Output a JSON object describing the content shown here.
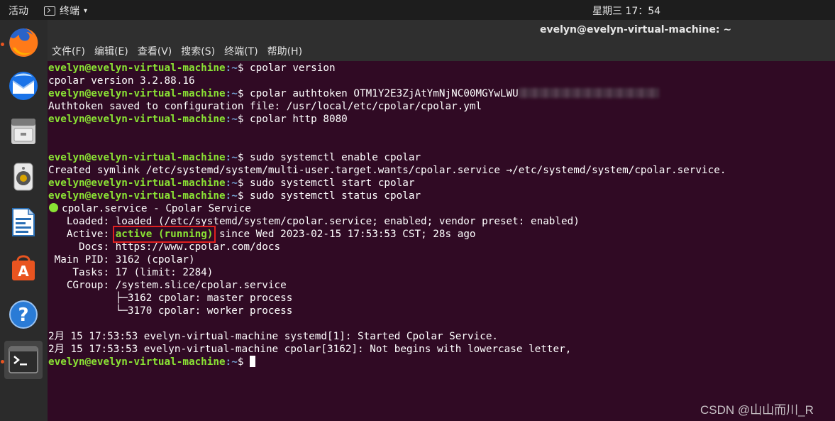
{
  "topbar": {
    "activities": "活动",
    "app_name": "终端",
    "caret": "▾",
    "clock": "星期三 17：54"
  },
  "window": {
    "title": "evelyn@evelyn-virtual-machine: ~",
    "menu": [
      "文件(F)",
      "编辑(E)",
      "查看(V)",
      "搜索(S)",
      "终端(T)",
      "帮助(H)"
    ]
  },
  "dock": {
    "items": [
      "firefox-icon",
      "thunderbird-icon",
      "files-icon",
      "rhythmbox-icon",
      "libreoffice-writer-icon",
      "software-center-icon",
      "help-icon",
      "terminal-icon"
    ]
  },
  "terminal": {
    "prompt_user": "evelyn@evelyn-virtual-machine",
    "prompt_path": ":~",
    "prompt_symbol": "$",
    "commands": {
      "c1": " cpolar version",
      "c2": " cpolar authtoken OTM1Y2E3ZjAtYmNjNC00MGYwLWU",
      "c3": " cpolar http 8080",
      "c4": " sudo systemctl enable cpolar",
      "c5": " sudo systemctl start cpolar",
      "c6": " sudo systemctl status cpolar"
    },
    "output": {
      "version": "cpolar version 3.2.88.16",
      "auth_saved": "Authtoken saved to configuration file: /usr/local/etc/cpolar/cpolar.yml",
      "symlink": "Created symlink /etc/systemd/system/multi-user.target.wants/cpolar.service →/etc/systemd/system/cpolar.service.",
      "service_title": "cpolar.service - Cpolar Service",
      "loaded": "   Loaded: loaded (/etc/systemd/system/cpolar.service; enabled; vendor preset: enabled)",
      "active_label": "   Active: ",
      "active_state": "active (running)",
      "active_rest": " since Wed 2023-02-15 17:53:53 CST; 28s ago",
      "docs": "     Docs: https://www.cpolar.com/docs",
      "main_pid": " Main PID: 3162 (cpolar)",
      "tasks": "    Tasks: 17 (limit: 2284)",
      "cgroup": "   CGroup: /system.slice/cpolar.service",
      "proc1": "           ├─3162 cpolar: master process",
      "proc2": "           └─3170 cpolar: worker process",
      "log1": "2月 15 17:53:53 evelyn-virtual-machine systemd[1]: Started Cpolar Service.",
      "log2": "2月 15 17:53:53 evelyn-virtual-machine cpolar[3162]: Not begins with lowercase letter,"
    }
  },
  "watermark": "CSDN @山山而川_R"
}
